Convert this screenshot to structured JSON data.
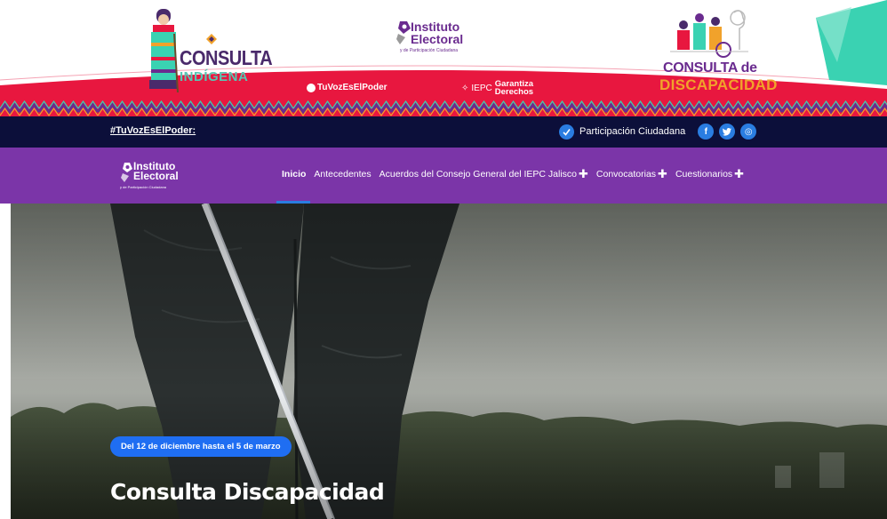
{
  "banner": {
    "indigena_title_1": "CONSULTA",
    "indigena_title_2": "INDÍGENA",
    "iepc_name": "Instituto Electoral",
    "iepc_line1": "Instituto",
    "iepc_line2": "Electoral",
    "iepc_sub": "y de Participación Ciudadana",
    "hashtag": "TuVozEsElPoder",
    "garantiza_prefix": "IEPC",
    "garantiza_line1": "Garantiza",
    "garantiza_line2": "Derechos",
    "discap_title_1": "CONSULTA de",
    "discap_title_2": "DISCAPACIDAD"
  },
  "topbar": {
    "hashtag": "#TuVozEsElPoder:",
    "participacion_label": "Participación Ciudadana",
    "social": {
      "facebook": "f",
      "twitter": "t",
      "instagram": "◎"
    }
  },
  "nav": {
    "logo_line1": "Instituto",
    "logo_line2": "Electoral",
    "logo_sub": "y de Participación Ciudadana",
    "items": [
      {
        "label": "Inicio",
        "active": true,
        "plus": ""
      },
      {
        "label": "Antecedentes",
        "active": false,
        "plus": ""
      },
      {
        "label": "Acuerdos del Consejo General del IEPC Jalisco",
        "active": false,
        "plus": "✚"
      },
      {
        "label": "Convocatorias",
        "active": false,
        "plus": "✚"
      },
      {
        "label": "Cuestionarios",
        "active": false,
        "plus": "✚"
      }
    ]
  },
  "hero": {
    "badge": "Del 12 de diciembre hasta el 5 de marzo",
    "title": "Consulta Discapacidad"
  },
  "colors": {
    "navy": "#0c0f3a",
    "purple": "#7b35a8",
    "accent_blue": "#1f6ef2",
    "banner_red": "#e8173f",
    "mint": "#3ad2b2"
  }
}
